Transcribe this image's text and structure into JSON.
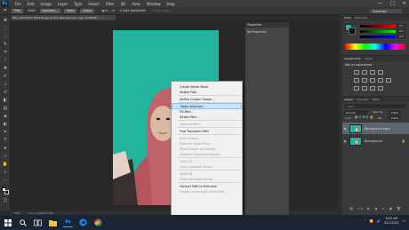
{
  "app": {
    "logo": "Ps"
  },
  "menubar": {
    "items": [
      "File",
      "Edit",
      "Image",
      "Layer",
      "Type",
      "Select",
      "Filter",
      "3D",
      "View",
      "Window",
      "Help"
    ],
    "window_controls": [
      "—",
      "□",
      "✕"
    ]
  },
  "options_bar": {
    "chips": [
      "Path",
      "Make:",
      "Selection...",
      "Mask",
      "Shape"
    ],
    "auto_add_delete": "Auto Add/Delete",
    "align_edges": "Align Edges",
    "workspace": "Essentials"
  },
  "document": {
    "tab_title": "IMG_20210216 083349.jpg @ 50% (Background copy, RGB/8#) *",
    "close": "×",
    "zoom": "50%",
    "doc_info": "Doc: 2.49M/4.79M"
  },
  "properties_panel": {
    "title": "Properties",
    "subtitle": "No Properties"
  },
  "right_panels": {
    "color_tabs": [
      "Color",
      "Swatches"
    ],
    "color_values": [
      "123",
      "123",
      "123"
    ],
    "adjustment_tabs": [
      "Adjustments",
      "Styles"
    ],
    "adjustment_title": "Add an adjustment",
    "layers_tabs": [
      "Layers",
      "Channels",
      "Paths"
    ],
    "blend_mode": "Normal",
    "opacity_label": "Opacity:",
    "opacity_value": "100%",
    "lock_label": "Lock:",
    "fill_label": "Fill:",
    "fill_value": "100%",
    "layers": [
      {
        "name": "Background copy",
        "selected": true
      },
      {
        "name": "Background",
        "selected": false
      }
    ]
  },
  "context_menu": {
    "items": [
      {
        "label": "Create Vector Mask",
        "disabled": false
      },
      {
        "label": "Delete Path",
        "disabled": false
      },
      {
        "sep": true
      },
      {
        "label": "Define Custom Shape...",
        "disabled": false
      },
      {
        "sep": true
      },
      {
        "label": "Make Selection...",
        "disabled": false,
        "highlight": true
      },
      {
        "label": "Fill Path...",
        "disabled": false
      },
      {
        "label": "Stroke Path...",
        "disabled": false
      },
      {
        "sep": true
      },
      {
        "label": "Clipping Path...",
        "disabled": true
      },
      {
        "sep": true
      },
      {
        "label": "Free Transform Path",
        "disabled": false
      },
      {
        "sep": true
      },
      {
        "label": "Unite Shapes",
        "disabled": true
      },
      {
        "label": "Subtract Front Shape",
        "disabled": true
      },
      {
        "label": "Unite Shapes at Overlap",
        "disabled": true
      },
      {
        "label": "Subtract Shapes at Overlap",
        "disabled": true
      },
      {
        "sep": true
      },
      {
        "label": "Copy Fill",
        "disabled": true
      },
      {
        "label": "Copy Complete Stroke",
        "disabled": true
      },
      {
        "sep": true
      },
      {
        "label": "Paste Fill",
        "disabled": true
      },
      {
        "label": "Paste Complete Stroke",
        "disabled": true
      },
      {
        "sep": true
      },
      {
        "label": "Convert Path to Extrusion",
        "disabled": false
      },
      {
        "label": "Create Constraint(s) from Path",
        "disabled": true
      }
    ]
  },
  "taskbar": {
    "icons": [
      "windows-icon",
      "search-icon",
      "task-view-icon",
      "file-explorer-icon",
      "photoshop-icon",
      "edge-icon",
      "chrome-icon"
    ],
    "time": "6:02 AM",
    "date": "3/21/2021"
  },
  "colors": {
    "canvas_background": "#23b49e",
    "hijab": "#c0626a",
    "accent_highlight": "#cce4f7"
  }
}
